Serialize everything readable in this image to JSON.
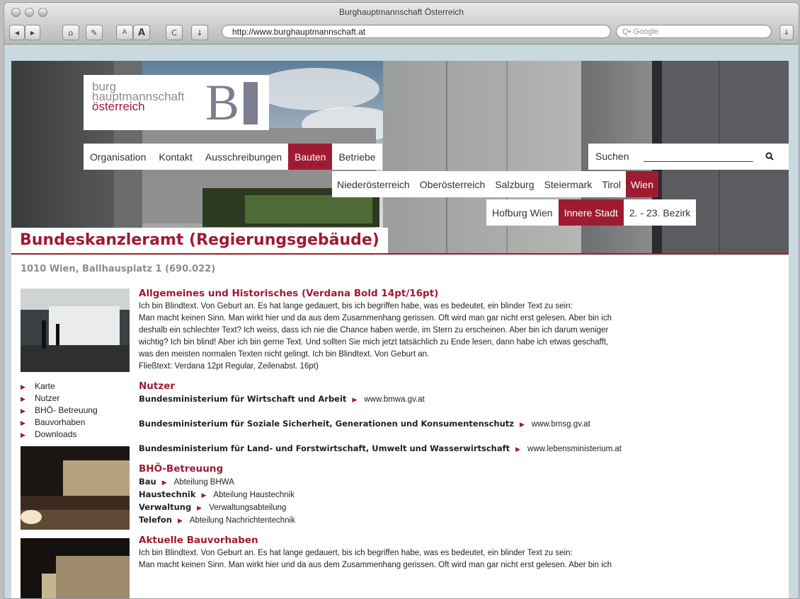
{
  "browser": {
    "window_title": "Burghauptmannschaft Österreich",
    "url": "http://www.burghauptmannschaft.at",
    "search_placeholder": "Q• Google",
    "buttons": [
      "◀",
      "▶",
      "⌂",
      "✎",
      "A",
      "A",
      "C",
      "↓"
    ]
  },
  "logo": {
    "line1": "burg",
    "line2": "hauptmannschaft",
    "line3": "österreich",
    "mark": "B"
  },
  "nav": {
    "main": [
      "Organisation",
      "Kontakt",
      "Ausschreibungen",
      "Bauten",
      "Betriebe"
    ],
    "main_active": "Bauten",
    "search_label": "Suchen",
    "regions": [
      "Niederösterreich",
      "Oberösterreich",
      "Salzburg",
      "Steiermark",
      "Tirol",
      "Wien"
    ],
    "regions_active": "Wien",
    "districts": [
      "Hofburg Wien",
      "Innere Stadt",
      "2. - 23. Bezirk"
    ],
    "districts_active": "Innere Stadt"
  },
  "page": {
    "title": "Bundeskanzleramt (Regierungsgebäude)",
    "address": "1010 Wien, Ballhausplatz 1 (690.022)"
  },
  "sidebar": {
    "links": [
      "Karte",
      "Nutzer",
      "BHÖ- Betreuung",
      "Bauvorhaben",
      "Downloads"
    ]
  },
  "sections": {
    "general": {
      "heading": "Allgemeines und Historisches (Verdana Bold 14pt/16pt)",
      "lines": [
        "Ich bin Blindtext. Von Geburt an. Es hat lange gedauert, bis ich begriffen habe, was es bedeutet, ein blinder Text zu sein:",
        "Man macht keinen Sinn. Man wirkt hier und da aus dem Zusammenhang gerissen. Oft wird man gar nicht erst gelesen. Aber bin ich",
        "deshalb ein schlechter Text? Ich weiss, dass ich nie die Chance haben werde, im Stern zu erscheinen. Aber bin ich darum weniger",
        "wichtig? Ich bin blind! Aber ich bin gerne Text. Und sollten Sie mich jetzt tatsächlich zu Ende lesen, dann habe ich etwas geschafft,",
        "was den meisten normalen Texten nicht gelingt. Ich bin Blindtext. Von Geburt an.",
        "Fließtext: Verdana 12pt Regular, Zeilenabst. 16pt)"
      ]
    },
    "users": {
      "heading": "Nutzer",
      "rows": [
        {
          "name": "Bundesministerium für Wirtschaft und Arbeit",
          "link": "www.bmwa.gv.at"
        },
        {
          "name": "Bundesministerium für Soziale Sicherheit, Generationen und Konsumentenschutz",
          "link": "www.bmsg.gv.at"
        },
        {
          "name": "Bundesministerium für Land- und Forstwirtschaft, Umwelt und Wasserwirtschaft",
          "link": "www.lebensministerium.at"
        }
      ]
    },
    "bho": {
      "heading": "BHÖ-Betreuung",
      "rows": [
        {
          "name": "Bau",
          "value": "Abteilung BHWA"
        },
        {
          "name": "Haustechnik",
          "value": "Abteilung Haustechnik"
        },
        {
          "name": "Verwaltung",
          "value": "Verwaltungsabteilung"
        },
        {
          "name": "Telefon",
          "value": "Abteilung Nachrichtentechnik"
        }
      ]
    },
    "projects": {
      "heading": "Aktuelle Bauvorhaben",
      "lines": [
        "Ich bin Blindtext. Von Geburt an. Es hat lange gedauert, bis ich begriffen habe, was es bedeutet, ein blinder Text zu sein:",
        "Man macht keinen Sinn. Man wirkt hier und da aus dem Zusammenhang gerissen. Oft wird man gar nicht erst gelesen. Aber bin ich"
      ]
    }
  },
  "colors": {
    "accent": "#9e1b32",
    "text": "#222222",
    "muted": "#8c8c8c"
  }
}
